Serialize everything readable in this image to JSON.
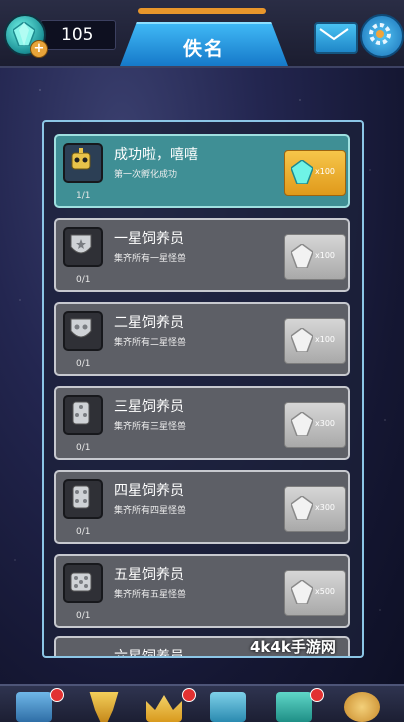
{
  "currency": {
    "gems": "105",
    "plus_symbol": "+"
  },
  "header": {
    "title": "佚名"
  },
  "achievements": [
    {
      "title": "成功啦，嘻嘻",
      "desc": "第一次孵化成功",
      "progress": "1/1",
      "reward": "x100",
      "completed": true
    },
    {
      "title": "一星饲养员",
      "desc": "集齐所有一星怪兽",
      "progress": "0/1",
      "reward": "x100",
      "completed": false
    },
    {
      "title": "二星饲养员",
      "desc": "集齐所有二星怪兽",
      "progress": "0/1",
      "reward": "x100",
      "completed": false
    },
    {
      "title": "三星饲养员",
      "desc": "集齐所有三星怪兽",
      "progress": "0/1",
      "reward": "x300",
      "completed": false
    },
    {
      "title": "四星饲养员",
      "desc": "集齐所有四星怪兽",
      "progress": "0/1",
      "reward": "x300",
      "completed": false
    },
    {
      "title": "五星饲养员",
      "desc": "集齐所有五星怪兽",
      "progress": "0/1",
      "reward": "x500",
      "completed": false
    }
  ],
  "partial_row_title": "六星饲养员",
  "watermark": "4k4k手游网",
  "colors": {
    "accent": "#2fa0e6",
    "completed_row": "#3f8f95",
    "reward_gold": "#e8a43a"
  }
}
